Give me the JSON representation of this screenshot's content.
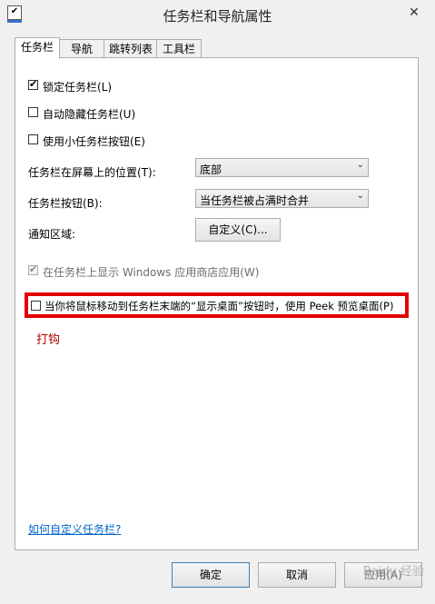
{
  "window": {
    "title": "任务栏和导航属性",
    "close_glyph": "✕",
    "icon_glyph": "✔"
  },
  "tabs": [
    {
      "label": "任务栏",
      "active": true
    },
    {
      "label": "导航",
      "active": false
    },
    {
      "label": "跳转列表",
      "active": false
    },
    {
      "label": "工具栏",
      "active": false
    }
  ],
  "options": {
    "lock_taskbar": {
      "label": "锁定任务栏(L)",
      "checked": true
    },
    "autohide": {
      "label": "自动隐藏任务栏(U)",
      "checked": false
    },
    "small_buttons": {
      "label": "使用小任务栏按钮(E)",
      "checked": false
    },
    "store_apps": {
      "label": "在任务栏上显示 Windows 应用商店应用(W)",
      "checked": true,
      "disabled": true
    },
    "peek": {
      "label": "当你将鼠标移动到任务栏末端的“显示桌面”按钮时，使用 Peek 预览桌面(P)",
      "checked": false
    }
  },
  "location": {
    "label": "任务栏在屏幕上的位置(T):",
    "value": "底部"
  },
  "buttons_combine": {
    "label": "任务栏按钮(B):",
    "value": "当任务栏被占满时合并"
  },
  "notification": {
    "label": "通知区域:",
    "button": "自定义(C)..."
  },
  "annotation": "打钩",
  "help_link": "如何自定义任务栏?",
  "footer": {
    "ok": "确定",
    "cancel": "取消",
    "apply": "应用(A)"
  },
  "watermark": "Baidu 经验",
  "colors": {
    "highlight_border": "#e10000",
    "annotation": "#b00000",
    "link": "#0066cc"
  }
}
